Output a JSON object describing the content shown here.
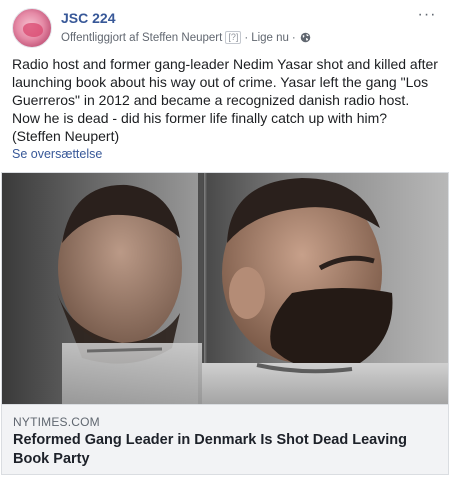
{
  "post": {
    "page_name": "JSC 224",
    "published_by": "Offentliggjort af Steffen Neupert",
    "help_marker": "[?]",
    "separator": "·",
    "time": "Lige nu",
    "separator2": "·",
    "more_label": "···",
    "text_lines": [
      "Radio host and former gang-leader Nedim Yasar shot and killed after launching book about his way out of crime. Yasar left the gang \"Los Guerreros\" in 2012 and became a recognized danish radio host.",
      "Now he is dead - did his former life finally catch up with him?",
      "(Steffen Neupert)"
    ],
    "translate_label": "Se oversættelse"
  },
  "link_preview": {
    "domain": "NYTIMES.COM",
    "title": "Reformed Gang Leader in Denmark Is Shot Dead Leaving Book Party"
  },
  "icons": {
    "avatar": "page-avatar",
    "visibility": "globe-icon",
    "more": "more-options-icon"
  },
  "colors": {
    "link_blue": "#385898",
    "meta_gray": "#616770",
    "caption_bg": "#f2f3f5"
  }
}
